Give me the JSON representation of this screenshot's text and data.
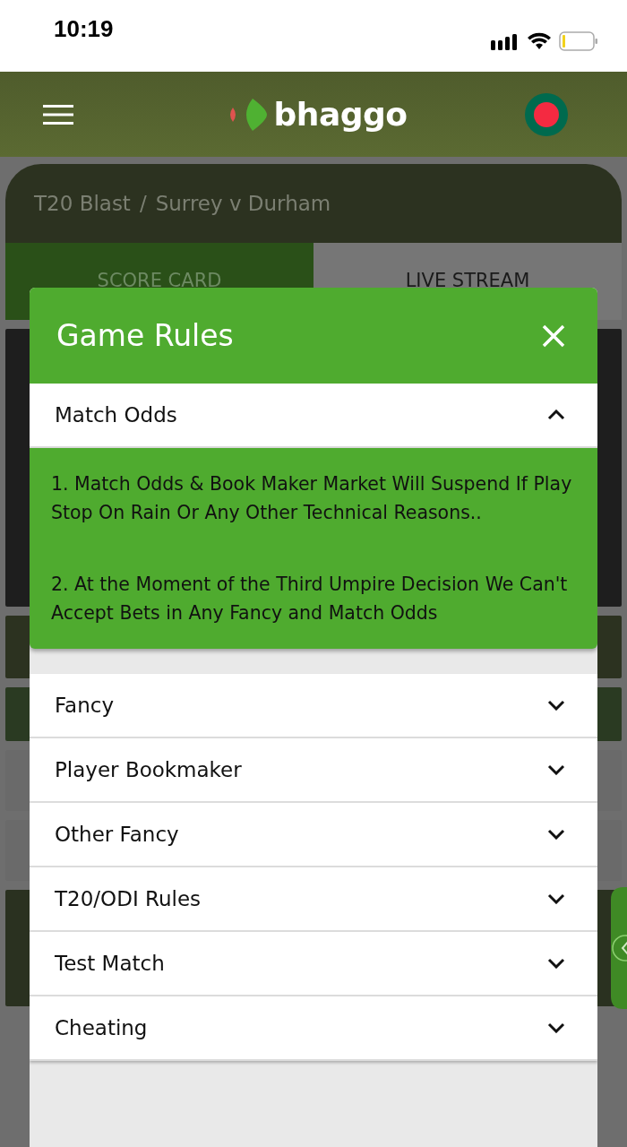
{
  "status_bar": {
    "time": "10:19"
  },
  "header": {
    "logo": "bhaggo"
  },
  "breadcrumb": {
    "league": "T20 Blast",
    "separator": "/",
    "match": "Surrey v Durham"
  },
  "tabs": [
    {
      "label": "SCORE CARD",
      "selected": true
    },
    {
      "label": "LIVE STREAM",
      "selected": false
    }
  ],
  "modal": {
    "title": "Game Rules",
    "sections": [
      {
        "title": "Match Odds",
        "expanded": true,
        "rules": [
          "1. Match Odds & Book Maker Market Will Suspend If Play Stop On Rain Or Any Other Technical Reasons..",
          "2. At the Moment of the Third Umpire Decision We Can't Accept Bets in Any Fancy and Match Odds"
        ]
      },
      {
        "title": "Fancy",
        "expanded": false
      },
      {
        "title": "Player Bookmaker",
        "expanded": false
      },
      {
        "title": "Other Fancy",
        "expanded": false
      },
      {
        "title": "T20/ODI Rules",
        "expanded": false
      },
      {
        "title": "Test Match",
        "expanded": false
      },
      {
        "title": "Cheating",
        "expanded": false
      }
    ]
  }
}
